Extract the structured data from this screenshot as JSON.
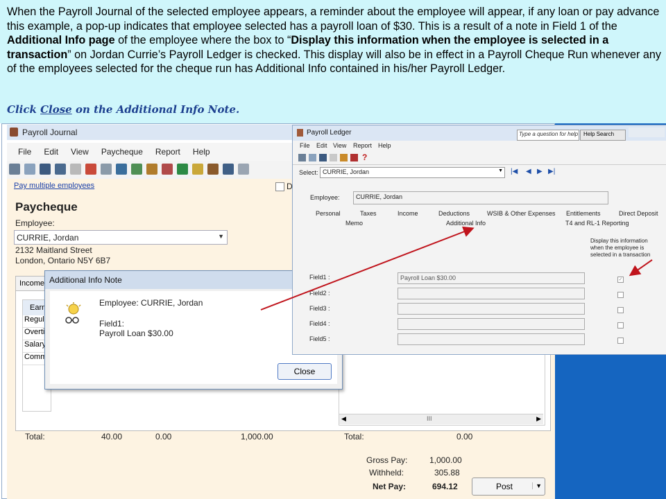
{
  "caption": {
    "intro": "When the  Payroll Journal of the selected employee appears, a reminder about the employee will appear, if any loan or pay advance this example, a pop-up indicates that employee selected has a payroll loan of $30. This is a result of a note in Field 1 of the ",
    "bold1": "Additional Info page",
    "mid1": " of the employee where the box to “",
    "bold2": "Display this information when the employee is selected in a transaction",
    "rest": "” on Jordan Currie’s Payroll Ledger is checked. This display will also be in effect in a Payroll Cheque Run whenever any of the employees selected for the cheque run has Additional Info contained in his/her Payroll Ledger.",
    "click_prefix": "Click ",
    "click_link": "Close",
    "click_suffix": " on the Additional Info Note."
  },
  "payroll_journal": {
    "title": "Payroll Journal",
    "menu": [
      "File",
      "Edit",
      "View",
      "Paycheque",
      "Report",
      "Help"
    ],
    "pay_multiple": "Pay multiple employees",
    "heading": "Paycheque",
    "employee_label": "Employee:",
    "employee_value": "CURRIE, Jordan",
    "address1": "2132 Maitland Street",
    "address2": "London, Ontario  N5Y 6B7",
    "tab_income": "Income",
    "rows": [
      "Regula",
      "Overti",
      "Salary",
      "Comm"
    ],
    "col_earn": "Earn",
    "scroll_mark": "III",
    "total_label": "Total:",
    "total_hours": "40.00",
    "total_col2": "0.00",
    "total_amount": "1,000.00",
    "total_label2": "Total:",
    "total_right": "0.00",
    "gross_label": "Gross Pay:",
    "gross_value": "1,000.00",
    "withheld_label": "Withheld:",
    "withheld_value": "305.88",
    "net_label": "Net Pay:",
    "net_value": "694.12",
    "post_label": "Post",
    "d_label": "D"
  },
  "dialog": {
    "title": "Additional Info Note",
    "employee_line": "Employee: CURRIE, Jordan",
    "field_label": "Field1:",
    "field_value": "Payroll Loan $30.00",
    "close": "Close"
  },
  "payroll_ledger": {
    "title": "Payroll Ledger",
    "search_placeholder": "Type a question for help",
    "help_search": "Help Search",
    "menu": [
      "File",
      "Edit",
      "View",
      "Report",
      "Help"
    ],
    "select_label": "Select:",
    "select_value": "CURRIE, Jordan",
    "employee_label": "Employee:",
    "employee_value": "CURRIE, Jordan",
    "tabs_row1": [
      "Personal",
      "Taxes",
      "Income",
      "Deductions",
      "WSIB & Other Expenses",
      "Entitlements",
      "Direct Deposit"
    ],
    "tabs_row2": [
      "Memo",
      "Additional Info",
      "T4 and RL-1 Reporting"
    ],
    "display_note": "Display this information when the employee is selected in a transaction",
    "fields": [
      {
        "label": "Field1 :",
        "value": "Payroll Loan $30.00",
        "checked": true
      },
      {
        "label": "Field2 :",
        "value": "",
        "checked": false
      },
      {
        "label": "Field3 :",
        "value": "",
        "checked": false
      },
      {
        "label": "Field4 :",
        "value": "",
        "checked": false
      },
      {
        "label": "Field5 :",
        "value": "",
        "checked": false
      }
    ]
  },
  "colors": {
    "caption_bg": "#cff6fb",
    "arrow": "#c0141c",
    "right_bg": "#1565c0",
    "link": "#1a3fa8"
  }
}
